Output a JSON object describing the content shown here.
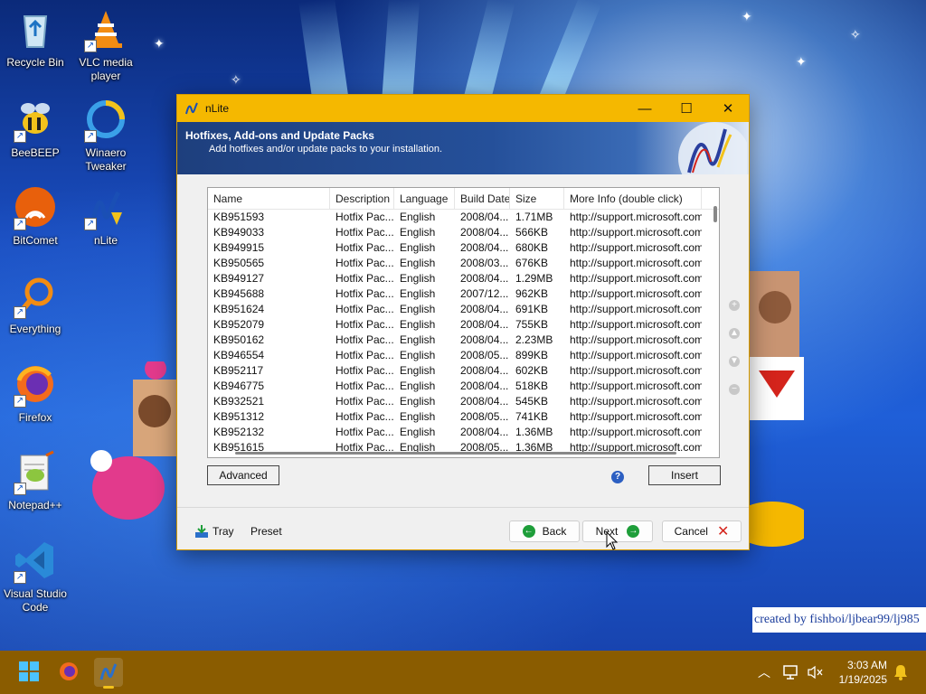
{
  "desktop": {
    "icons": [
      {
        "label": "Recycle Bin"
      },
      {
        "label": "VLC media player"
      },
      {
        "label": "BeeBEEP"
      },
      {
        "label": "Winaero Tweaker"
      },
      {
        "label": "BitComet"
      },
      {
        "label": "nLite"
      },
      {
        "label": "Everything"
      },
      {
        "label": "Firefox"
      },
      {
        "label": "Notepad++"
      },
      {
        "label": "Visual Studio Code"
      }
    ],
    "watermark": "created by fishboi/ljbear99/lj985"
  },
  "window": {
    "title": "nLite",
    "controls": {
      "minimize": "—",
      "maximize": "☐",
      "close": "✕"
    },
    "banner": {
      "heading": "Hotfixes, Add-ons and Update Packs",
      "subheading": "Add hotfixes and/or update packs to your installation."
    },
    "list": {
      "columns": [
        "Name",
        "Description",
        "Language",
        "Build Date",
        "Size",
        "More Info (double click)"
      ],
      "rows": [
        [
          "KB951593",
          "Hotfix Pac...",
          "English",
          "2008/04...",
          "1.71MB",
          "http://support.microsoft.com?..."
        ],
        [
          "KB949033",
          "Hotfix Pac...",
          "English",
          "2008/04...",
          "566KB",
          "http://support.microsoft.com?..."
        ],
        [
          "KB949915",
          "Hotfix Pac...",
          "English",
          "2008/04...",
          "680KB",
          "http://support.microsoft.com?..."
        ],
        [
          "KB950565",
          "Hotfix Pac...",
          "English",
          "2008/03...",
          "676KB",
          "http://support.microsoft.com?..."
        ],
        [
          "KB949127",
          "Hotfix Pac...",
          "English",
          "2008/04...",
          "1.29MB",
          "http://support.microsoft.com?..."
        ],
        [
          "KB945688",
          "Hotfix Pac...",
          "English",
          "2007/12...",
          "962KB",
          "http://support.microsoft.com?..."
        ],
        [
          "KB951624",
          "Hotfix Pac...",
          "English",
          "2008/04...",
          "691KB",
          "http://support.microsoft.com?..."
        ],
        [
          "KB952079",
          "Hotfix Pac...",
          "English",
          "2008/04...",
          "755KB",
          "http://support.microsoft.com?..."
        ],
        [
          "KB950162",
          "Hotfix Pac...",
          "English",
          "2008/04...",
          "2.23MB",
          "http://support.microsoft.com?..."
        ],
        [
          "KB946554",
          "Hotfix Pac...",
          "English",
          "2008/05...",
          "899KB",
          "http://support.microsoft.com?..."
        ],
        [
          "KB952117",
          "Hotfix Pac...",
          "English",
          "2008/04...",
          "602KB",
          "http://support.microsoft.com?..."
        ],
        [
          "KB946775",
          "Hotfix Pac...",
          "English",
          "2008/04...",
          "518KB",
          "http://support.microsoft.com?..."
        ],
        [
          "KB932521",
          "Hotfix Pac...",
          "English",
          "2008/04...",
          "545KB",
          "http://support.microsoft.com?..."
        ],
        [
          "KB951312",
          "Hotfix Pac...",
          "English",
          "2008/05...",
          "741KB",
          "http://support.microsoft.com?..."
        ],
        [
          "KB952132",
          "Hotfix Pac...",
          "English",
          "2008/04...",
          "1.36MB",
          "http://support.microsoft.com?..."
        ],
        [
          "KB951615",
          "Hotfix Pac...",
          "English",
          "2008/05...",
          "1.36MB",
          "http://support.microsoft.com?..."
        ]
      ]
    },
    "buttons": {
      "advanced": "Advanced",
      "insert": "Insert",
      "help": "?",
      "tray": "Tray",
      "preset": "Preset",
      "back": "Back",
      "next": "Next",
      "cancel": "Cancel"
    }
  },
  "taskbar": {
    "time": "3:03 AM",
    "date": "1/19/2025"
  },
  "colors": {
    "titlebar": "#f5b800",
    "banner": "#1e3f7d",
    "taskbar": "#8a5c00"
  }
}
